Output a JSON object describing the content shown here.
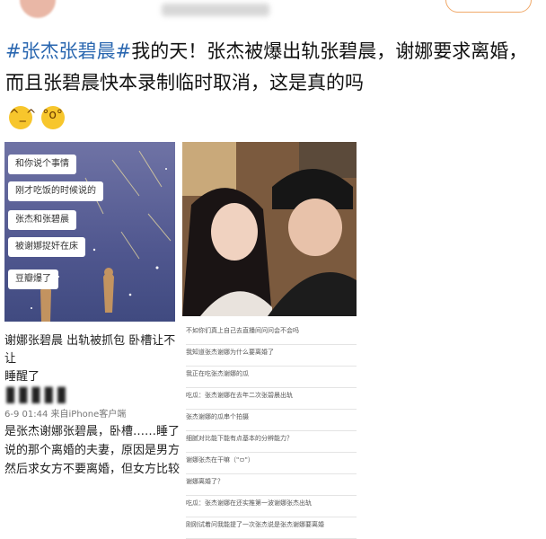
{
  "header": {
    "avatar": "user-avatar",
    "username_blurred": "",
    "follow": ""
  },
  "post": {
    "hashtag": "#张杰张碧晨#",
    "text": "我的天！张杰被爆出轨张碧晨，谢娜要求离婚，而且张碧晨快本录制临时取消，这是真的吗",
    "emoji1": "grinning-sweat-emoji",
    "emoji2": "shocked-emoji"
  },
  "left_image": {
    "bubbles": [
      "和你说个事情",
      "刚才吃饭的时候说的",
      "张杰和张碧晨",
      "被谢娜捉奸在床",
      "豆瓣爆了"
    ]
  },
  "left_caption": {
    "line1": "谢娜张碧晨 出轨被抓包 卧槽让不让",
    "line2": "睡醒了"
  },
  "left_post": {
    "meta": "6-9 01:44  来自iPhone客户端",
    "lines": [
      "是张杰谢娜张碧晨，卧槽……睡了先",
      "说的那个离婚的夫妻，原因是男方",
      "然后求女方不要离婚，但女方比较"
    ]
  },
  "comments": [
    "不如你们真上自己去直播间问问会不会吗",
    "我知道张杰谢娜为什么要离婚了",
    "我正在吃张杰谢娜的瓜",
    "吃瓜：张杰谢娜在去年二次张碧晨出轨",
    "张杰谢娜的瓜串个拍摄",
    "细腻对比能下能有点基本的分辨能力？",
    "谢娜张杰在干嘛（\"ㅁ\"）",
    "谢娜离婚了？",
    "吃瓜：张杰谢娜在还实推第一波谢娜张杰出轨",
    "刚刚试着问我能提了一次张杰说是张杰谢娜要离婚"
  ]
}
